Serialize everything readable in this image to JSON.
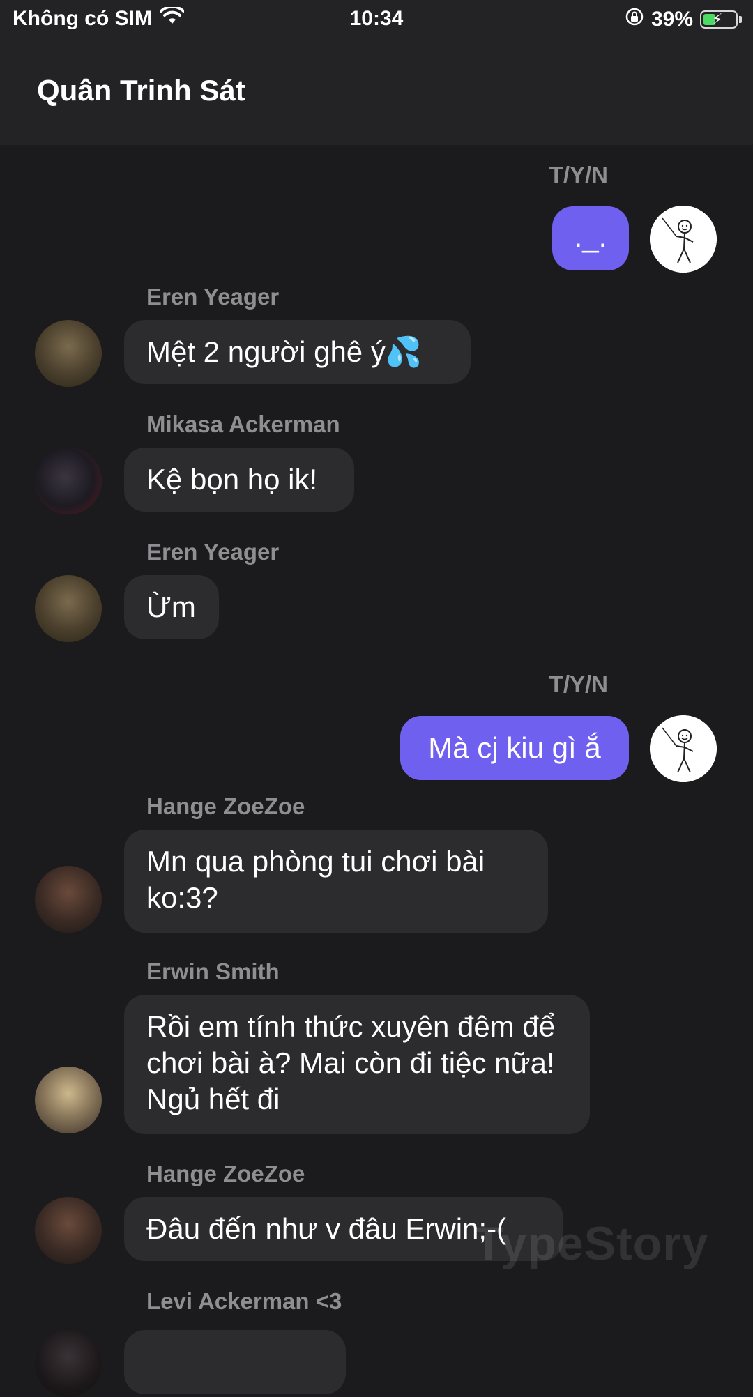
{
  "status_bar": {
    "carrier": "Không có SIM",
    "time": "10:34",
    "battery": "39%",
    "battery_level": 0.39,
    "icons": [
      "wifi-icon",
      "orientation-lock-icon",
      "battery-charging-icon"
    ]
  },
  "header": {
    "title": "Quân Trinh Sát"
  },
  "messages": [
    {
      "sender": "T/Y/N",
      "text": "._."
    },
    {
      "sender": "Eren Yeager",
      "text": "Mệt 2 người ghê ý💦"
    },
    {
      "sender": "Mikasa Ackerman",
      "text": "Kệ bọn họ ik!"
    },
    {
      "sender": "Eren Yeager",
      "text": "Ừm"
    },
    {
      "sender": "T/Y/N",
      "text": "Mà cj kiu gì ắ"
    },
    {
      "sender": "Hange ZoeZoe",
      "text": "Mn qua phòng tui chơi bài ko:3?"
    },
    {
      "sender": "Erwin Smith",
      "text": "Rồi em tính thức xuyên đêm để chơi bài à? Mai còn đi tiệc nữa! Ngủ hết đi"
    },
    {
      "sender": "Hange ZoeZoe",
      "text": "Đâu đến như v đâu Erwin;-("
    },
    {
      "sender": "Levi Ackerman <3",
      "text": ""
    }
  ],
  "watermark": "TypeStory",
  "colors": {
    "background": "#1b1b1d",
    "header": "#232325",
    "bubble_other": "#2c2c2e",
    "bubble_self": "#7060f0",
    "sender_name": "#8e8e93"
  }
}
